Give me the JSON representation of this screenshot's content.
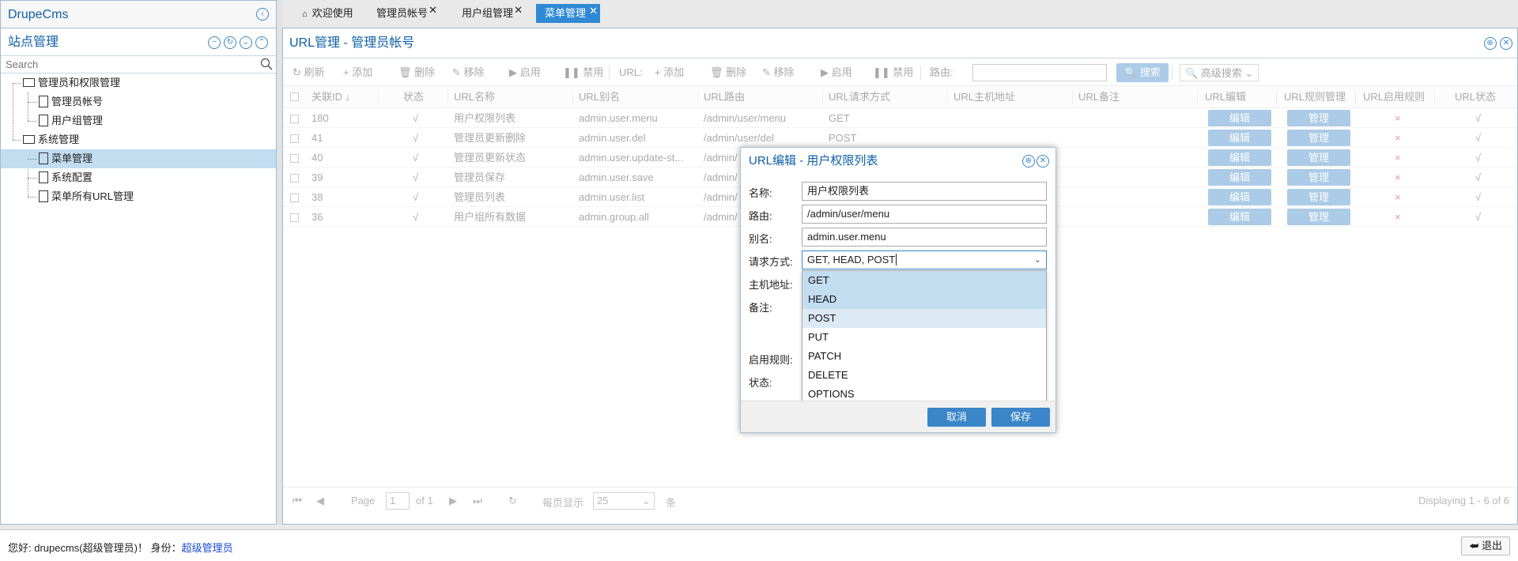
{
  "app": {
    "title": "DrupeCms"
  },
  "sidebar": {
    "section_title": "站点管理",
    "search_placeholder": "Search",
    "tree": [
      {
        "label": "管理员和权限管理",
        "type": "folder",
        "level": 0
      },
      {
        "label": "管理员帐号",
        "type": "doc",
        "level": 1
      },
      {
        "label": "用户组管理",
        "type": "doc",
        "level": 1
      },
      {
        "label": "系统管理",
        "type": "folder",
        "level": 0
      },
      {
        "label": "菜单管理",
        "type": "doc",
        "level": 1,
        "selected": true
      },
      {
        "label": "系统配置",
        "type": "doc",
        "level": 1
      },
      {
        "label": "菜单所有URL管理",
        "type": "doc",
        "level": 1
      }
    ]
  },
  "tabs": [
    {
      "label": "欢迎使用",
      "icon": "home-icon"
    },
    {
      "label": "管理员帐号",
      "closable": true
    },
    {
      "label": "用户组管理",
      "closable": true
    },
    {
      "label": "菜单管理",
      "closable": true,
      "active": true
    }
  ],
  "main": {
    "title": "URL管理 - 管理员帐号",
    "toolbar": {
      "refresh": "刷新",
      "add": "添加",
      "delete": "删除",
      "move": "移除",
      "enable": "启用",
      "disable": "禁用",
      "url_label": "URL:",
      "url_add": "添加",
      "url_delete": "删除",
      "url_move": "移除",
      "url_enable": "启用",
      "url_disable": "禁用",
      "route_label": "路由:",
      "search": "搜索",
      "advanced_search": "高级搜索"
    },
    "columns": [
      "关联ID ↓",
      "状态",
      "URL名称",
      "URL别名",
      "URL路由",
      "URL请求方式",
      "URL主机地址",
      "URL备注",
      "URL编辑",
      "URL规则管理",
      "URL启用规则",
      "URL状态"
    ],
    "rows": [
      {
        "id": "180",
        "status": "√",
        "name": "用户权限列表",
        "alias": "admin.user.menu",
        "route": "/admin/user/menu",
        "method": "GET",
        "edit": "编辑",
        "manage": "管理",
        "rule": "×",
        "url_status": "√"
      },
      {
        "id": "41",
        "status": "√",
        "name": "管理员更新删除",
        "alias": "admin.user.del",
        "route": "/admin/user/del",
        "method": "POST",
        "edit": "编辑",
        "manage": "管理",
        "rule": "×",
        "url_status": "√"
      },
      {
        "id": "40",
        "status": "√",
        "name": "管理员更新状态",
        "alias": "admin.user.update-st...",
        "route": "/admin/",
        "method": "",
        "edit": "编辑",
        "manage": "管理",
        "rule": "×",
        "url_status": "√"
      },
      {
        "id": "39",
        "status": "√",
        "name": "管理员保存",
        "alias": "admin.user.save",
        "route": "/admin/",
        "method": "",
        "edit": "编辑",
        "manage": "管理",
        "rule": "×",
        "url_status": "√"
      },
      {
        "id": "38",
        "status": "√",
        "name": "管理员列表",
        "alias": "admin.user.list",
        "route": "/admin/",
        "method": "",
        "edit": "编辑",
        "manage": "管理",
        "rule": "×",
        "url_status": "√"
      },
      {
        "id": "36",
        "status": "√",
        "name": "用户组所有数据",
        "alias": "admin.group.all",
        "route": "/admin/",
        "method": "",
        "edit": "编辑",
        "manage": "管理",
        "rule": "×",
        "url_status": "√"
      }
    ],
    "pager": {
      "page_label": "Page",
      "page_value": "1",
      "of_label": "of 1",
      "per_page_label": "每页显示",
      "per_page_value": "25",
      "unit": "条",
      "displaying": "Displaying 1 - 6 of 6"
    }
  },
  "dialog": {
    "title": "URL编辑 - 用户权限列表",
    "fields": {
      "name_label": "名称:",
      "name_value": "用户权限列表",
      "route_label": "路由:",
      "route_value": "/admin/user/menu",
      "alias_label": "别名:",
      "alias_value": "admin.user.menu",
      "method_label": "请求方式:",
      "method_value": "GET, HEAD, POST",
      "host_label": "主机地址:",
      "remark_label": "备注:",
      "rule_label": "启用规则:",
      "status_label": "状态:"
    },
    "options": [
      {
        "label": "GET",
        "state": "selected"
      },
      {
        "label": "HEAD",
        "state": "selected"
      },
      {
        "label": "POST",
        "state": "hover"
      },
      {
        "label": "PUT",
        "state": ""
      },
      {
        "label": "PATCH",
        "state": ""
      },
      {
        "label": "DELETE",
        "state": ""
      },
      {
        "label": "OPTIONS",
        "state": ""
      }
    ],
    "cancel": "取消",
    "save": "保存"
  },
  "status_bar": {
    "greeting": "您好: drupecms(超级管理员)！ 身份：",
    "role": "超级管理员",
    "logout": "退出"
  },
  "colors": {
    "accent": "#2f8ad6",
    "title_text": "#0e5fa8",
    "selected_row": "#c2dcf0"
  }
}
